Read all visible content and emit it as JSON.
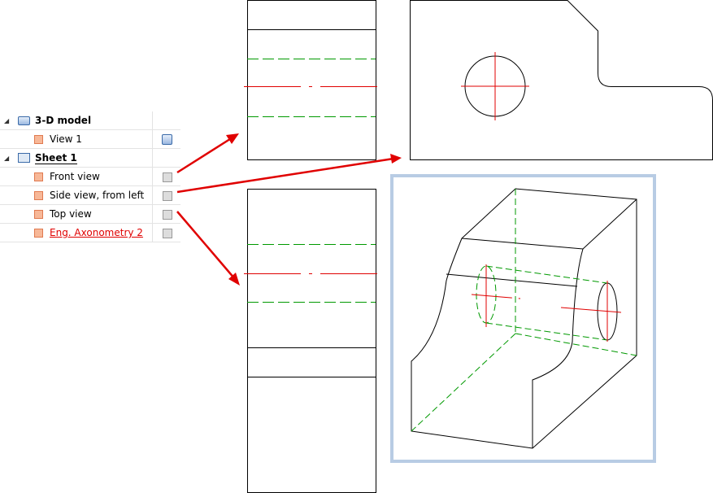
{
  "tree": {
    "items": [
      {
        "label": "3-D model",
        "level": 0,
        "expanded": true,
        "icon": "3d-model-icon"
      },
      {
        "label": "View 1",
        "level": 1,
        "icon": "view-cube-icon",
        "status_icon": "shaded-cube-icon"
      },
      {
        "label": "Sheet 1",
        "level": 0,
        "expanded": true,
        "icon": "sheet-icon"
      },
      {
        "label": "Front view",
        "level": 1,
        "icon": "view-cube-icon",
        "status_icon": "wireframe-cube-icon"
      },
      {
        "label": "Side view, from left",
        "level": 1,
        "icon": "view-cube-icon",
        "status_icon": "wireframe-cube-icon"
      },
      {
        "label": "Top view",
        "level": 1,
        "icon": "view-cube-icon",
        "status_icon": "wireframe-cube-icon"
      },
      {
        "label": "Eng. Axonometry 2",
        "level": 1,
        "icon": "view-cube-icon",
        "status_icon": "wireframe-cube-icon",
        "active": true
      }
    ]
  },
  "colors": {
    "arrow": "#e00000",
    "hidden_line": "#009900",
    "center_line": "#e00000",
    "selection_frame": "#b8cce4"
  }
}
